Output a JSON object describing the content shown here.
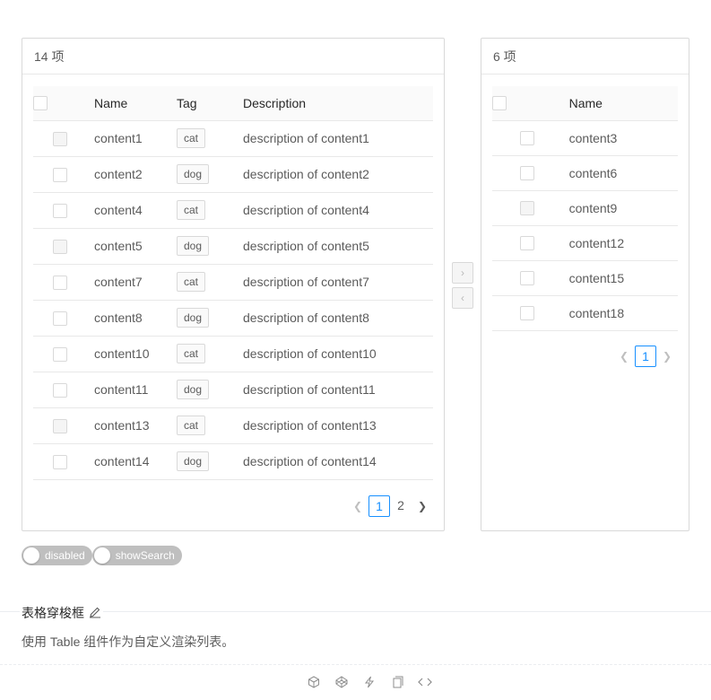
{
  "left": {
    "count_label": "14 项",
    "columns": {
      "name": "Name",
      "tag": "Tag",
      "description": "Description"
    },
    "rows": [
      {
        "name": "content1",
        "tag": "cat",
        "description": "description of content1",
        "disabled": true
      },
      {
        "name": "content2",
        "tag": "dog",
        "description": "description of content2",
        "disabled": false
      },
      {
        "name": "content4",
        "tag": "cat",
        "description": "description of content4",
        "disabled": false
      },
      {
        "name": "content5",
        "tag": "dog",
        "description": "description of content5",
        "disabled": true
      },
      {
        "name": "content7",
        "tag": "cat",
        "description": "description of content7",
        "disabled": false
      },
      {
        "name": "content8",
        "tag": "dog",
        "description": "description of content8",
        "disabled": false
      },
      {
        "name": "content10",
        "tag": "cat",
        "description": "description of content10",
        "disabled": false
      },
      {
        "name": "content11",
        "tag": "dog",
        "description": "description of content11",
        "disabled": false
      },
      {
        "name": "content13",
        "tag": "cat",
        "description": "description of content13",
        "disabled": true
      },
      {
        "name": "content14",
        "tag": "dog",
        "description": "description of content14",
        "disabled": false
      }
    ],
    "pagination": {
      "pages": [
        "1",
        "2"
      ],
      "current": "1"
    }
  },
  "right": {
    "count_label": "6 项",
    "columns": {
      "name": "Name"
    },
    "rows": [
      {
        "name": "content3",
        "disabled": false
      },
      {
        "name": "content6",
        "disabled": false
      },
      {
        "name": "content9",
        "disabled": true
      },
      {
        "name": "content12",
        "disabled": false
      },
      {
        "name": "content15",
        "disabled": false
      },
      {
        "name": "content18",
        "disabled": false
      }
    ],
    "pagination": {
      "pages": [
        "1"
      ],
      "current": "1"
    }
  },
  "operations": {
    "to_right": "›",
    "to_left": "‹"
  },
  "switches": {
    "disabled_label": "disabled",
    "show_search_label": "showSearch"
  },
  "section": {
    "title": "表格穿梭框",
    "description": "使用 Table 组件作为自定义渲染列表。"
  },
  "colors": {
    "accent": "#1890ff",
    "border": "#d9d9d9"
  },
  "icons": [
    "codesandbox-icon",
    "codepen-icon",
    "thunderbolt-icon",
    "copy-icon",
    "code-icon"
  ]
}
